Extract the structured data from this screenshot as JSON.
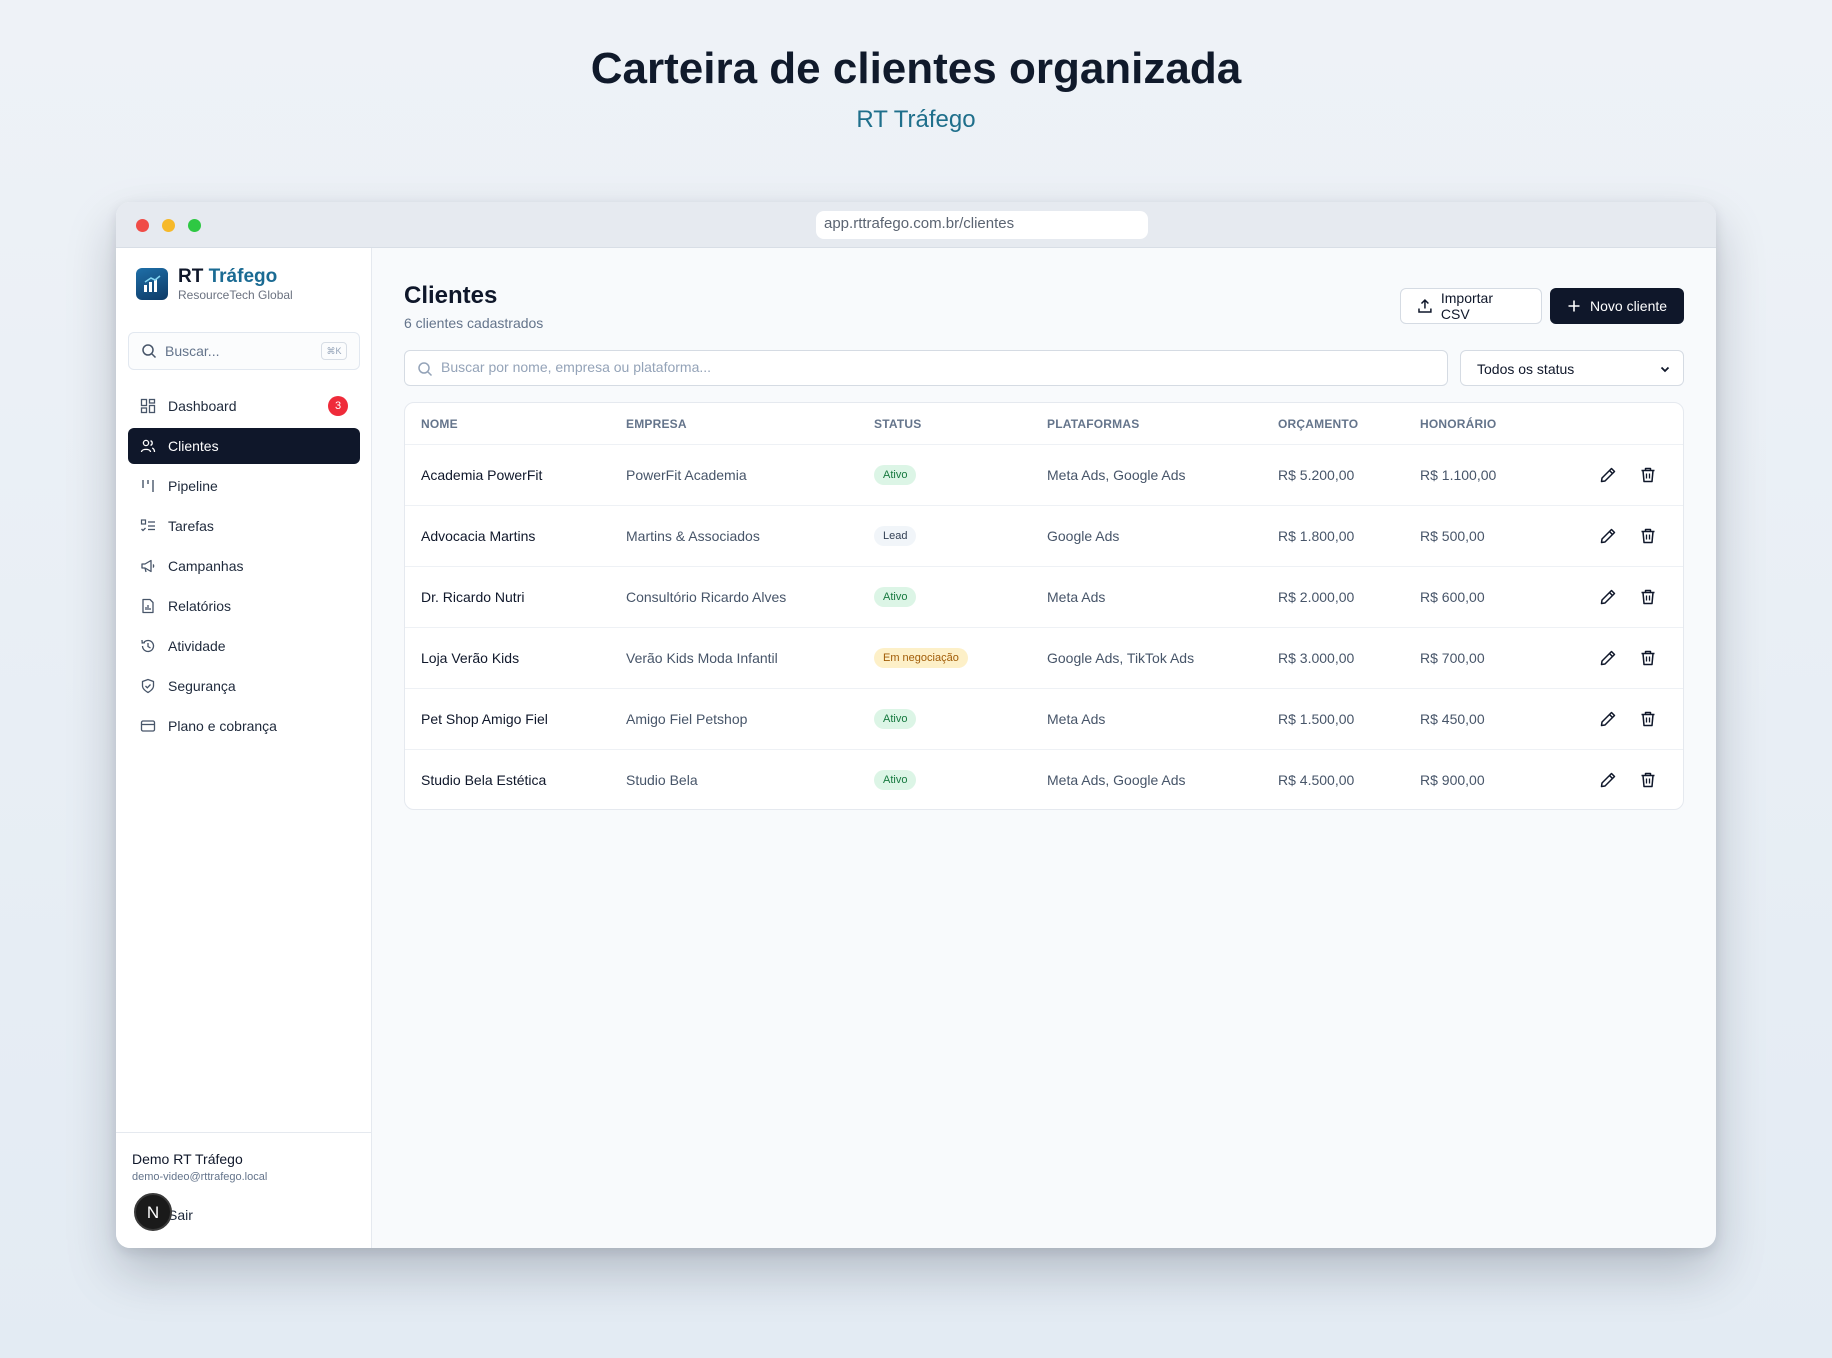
{
  "hero": {
    "title": "Carteira de clientes organizada",
    "subtitle": "RT Tráfego"
  },
  "browser": {
    "url": "app.rttrafego.com.br/clientes"
  },
  "sidebar": {
    "brand": {
      "name_part1": "RT",
      "name_part2": "Tráfego",
      "subtitle": "ResourceTech Global"
    },
    "search": {
      "placeholder": "Buscar...",
      "shortcut": "⌘K"
    },
    "items": [
      {
        "label": "Dashboard",
        "icon": "dashboard-icon",
        "badge": "3"
      },
      {
        "label": "Clientes",
        "icon": "users-icon",
        "active": true
      },
      {
        "label": "Pipeline",
        "icon": "pipeline-icon"
      },
      {
        "label": "Tarefas",
        "icon": "tasks-icon"
      },
      {
        "label": "Campanhas",
        "icon": "megaphone-icon"
      },
      {
        "label": "Relatórios",
        "icon": "report-icon"
      },
      {
        "label": "Atividade",
        "icon": "history-icon"
      },
      {
        "label": "Segurança",
        "icon": "shield-icon"
      },
      {
        "label": "Plano e cobrança",
        "icon": "credit-card-icon"
      }
    ],
    "user": {
      "name": "Demo RT Tráfego",
      "email": "demo-video@rttrafego.local",
      "logout": "Sair",
      "avatar": "N"
    }
  },
  "main": {
    "title": "Clientes",
    "subtitle": "6 clientes cadastrados",
    "import_label": "Importar CSV",
    "new_label": "Novo cliente",
    "search_placeholder": "Buscar por nome, empresa ou plataforma...",
    "status_filter": "Todos os status",
    "columns": [
      "NOME",
      "EMPRESA",
      "STATUS",
      "PLATAFORMAS",
      "ORÇAMENTO",
      "HONORÁRIO"
    ],
    "rows": [
      {
        "name": "Academia PowerFit",
        "company": "PowerFit Academia",
        "status": "Ativo",
        "status_kind": "ativo",
        "platforms": "Meta Ads, Google Ads",
        "budget": "R$ 5.200,00",
        "fee": "R$ 1.100,00"
      },
      {
        "name": "Advocacia Martins",
        "company": "Martins & Associados",
        "status": "Lead",
        "status_kind": "lead",
        "platforms": "Google Ads",
        "budget": "R$ 1.800,00",
        "fee": "R$ 500,00"
      },
      {
        "name": "Dr. Ricardo Nutri",
        "company": "Consultório Ricardo Alves",
        "status": "Ativo",
        "status_kind": "ativo",
        "platforms": "Meta Ads",
        "budget": "R$ 2.000,00",
        "fee": "R$ 600,00"
      },
      {
        "name": "Loja Verão Kids",
        "company": "Verão Kids Moda Infantil",
        "status": "Em negociação",
        "status_kind": "neg",
        "platforms": "Google Ads, TikTok Ads",
        "budget": "R$ 3.000,00",
        "fee": "R$ 700,00"
      },
      {
        "name": "Pet Shop Amigo Fiel",
        "company": "Amigo Fiel Petshop",
        "status": "Ativo",
        "status_kind": "ativo",
        "platforms": "Meta Ads",
        "budget": "R$ 1.500,00",
        "fee": "R$ 450,00"
      },
      {
        "name": "Studio Bela Estética",
        "company": "Studio Bela",
        "status": "Ativo",
        "status_kind": "ativo",
        "platforms": "Meta Ads, Google Ads",
        "budget": "R$ 4.500,00",
        "fee": "R$ 900,00"
      }
    ]
  },
  "colors": {
    "primary": "#0f172a",
    "accent": "#1b6b93",
    "badge": "#ef2b3a",
    "active_pill": "#dcf5e6",
    "negotiation_pill": "#fdf0c8"
  }
}
